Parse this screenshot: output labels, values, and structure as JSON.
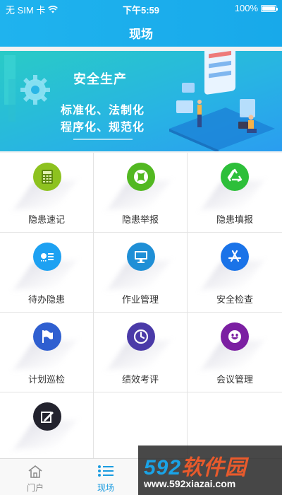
{
  "status_bar": {
    "carrier": "无 SIM 卡",
    "time": "下午5:59",
    "battery": "100%"
  },
  "nav": {
    "title": "现场"
  },
  "banner": {
    "heading": "安全生产",
    "line1": "标准化、法制化",
    "line2": "程序化、规范化"
  },
  "grid": [
    {
      "label": "隐患速记",
      "icon": "calculator-icon",
      "color": "#8dc21f"
    },
    {
      "label": "隐患举报",
      "icon": "xbox-icon",
      "color": "#52b821"
    },
    {
      "label": "隐患填报",
      "icon": "recycle-icon",
      "color": "#2dbf3a"
    },
    {
      "label": "待办隐患",
      "icon": "list-icon",
      "color": "#1da1f2"
    },
    {
      "label": "作业管理",
      "icon": "monitor-icon",
      "color": "#1f8fd6"
    },
    {
      "label": "安全检查",
      "icon": "app-store-icon",
      "color": "#1a73e8"
    },
    {
      "label": "计划巡检",
      "icon": "flag-icon",
      "color": "#2f5fd0"
    },
    {
      "label": "绩效考评",
      "icon": "clock-icon",
      "color": "#4a3aa8"
    },
    {
      "label": "会议管理",
      "icon": "smile-icon",
      "color": "#7b1fa2"
    },
    {
      "label": "",
      "icon": "edit-icon",
      "color": "#23232e"
    }
  ],
  "tabs": [
    {
      "label": "门户",
      "icon": "home-icon",
      "active": false
    },
    {
      "label": "现场",
      "icon": "list-icon",
      "active": true
    }
  ],
  "watermark": {
    "brand_num": "592",
    "brand_text": "软件园",
    "url": "www.592xiazai.com"
  },
  "colors": {
    "header": "#1fb3ee",
    "active_tab": "#1a9be0",
    "inactive_tab": "#8a8a8a"
  }
}
